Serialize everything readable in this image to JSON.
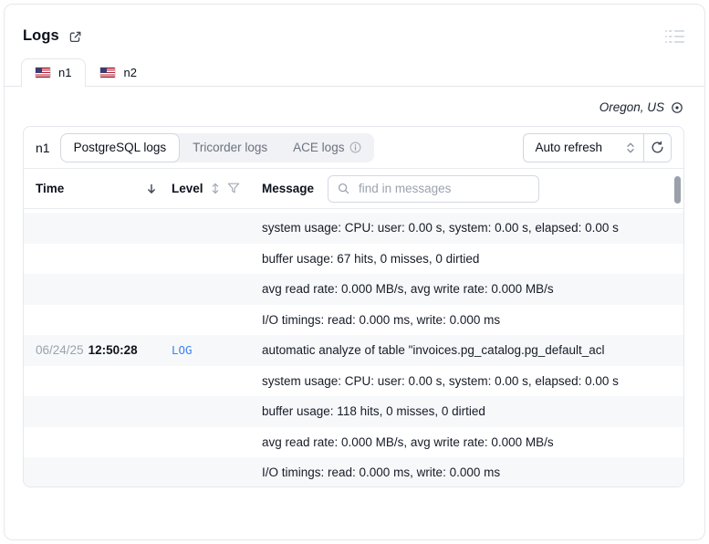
{
  "title": "Logs",
  "tabs": [
    {
      "label": "n1",
      "active": true,
      "flag": "us-flag"
    },
    {
      "label": "n2",
      "active": false,
      "flag": "us-flag"
    }
  ],
  "region": {
    "label": "Oregon, US"
  },
  "toolbar": {
    "instance": "n1",
    "log_source_tabs": [
      {
        "label": "PostgreSQL logs",
        "active": true
      },
      {
        "label": "Tricorder logs",
        "active": false
      },
      {
        "label": "ACE logs",
        "active": false,
        "info": true
      }
    ],
    "refresh_select": "Auto refresh"
  },
  "table": {
    "columns": {
      "time": "Time",
      "level": "Level",
      "message": "Message"
    },
    "search": {
      "placeholder": "find in messages",
      "value": ""
    },
    "rows": [
      {
        "date": "",
        "time": "",
        "level": "",
        "message": "system usage: CPU: user: 0.00 s, system: 0.00 s, elapsed: 0.00 s"
      },
      {
        "date": "",
        "time": "",
        "level": "",
        "message": "buffer usage: 67 hits, 0 misses, 0 dirtied"
      },
      {
        "date": "",
        "time": "",
        "level": "",
        "message": "avg read rate: 0.000 MB/s, avg write rate: 0.000 MB/s"
      },
      {
        "date": "",
        "time": "",
        "level": "",
        "message": "I/O timings: read: 0.000 ms, write: 0.000 ms"
      },
      {
        "date": "06/24/25",
        "time": "12:50:28",
        "level": "LOG",
        "message": "automatic analyze of table \"invoices.pg_catalog.pg_default_acl"
      },
      {
        "date": "",
        "time": "",
        "level": "",
        "message": "system usage: CPU: user: 0.00 s, system: 0.00 s, elapsed: 0.00 s"
      },
      {
        "date": "",
        "time": "",
        "level": "",
        "message": "buffer usage: 118 hits, 0 misses, 0 dirtied"
      },
      {
        "date": "",
        "time": "",
        "level": "",
        "message": "avg read rate: 0.000 MB/s, avg write rate: 0.000 MB/s"
      },
      {
        "date": "",
        "time": "",
        "level": "",
        "message": "I/O timings: read: 0.000 ms, write: 0.000 ms"
      }
    ]
  },
  "icons": {
    "external-link": "box with arrow pointing out top-right",
    "widget-menu": "three-line list glyph (drag/menu)",
    "location": "circle with center dot",
    "select-chevrons": "up and down chevrons",
    "refresh": "circular arrow",
    "sort-desc": "down arrow",
    "sort-both": "double-headed vertical arrow",
    "filter": "funnel outline",
    "search": "magnifier",
    "info": "circled i"
  },
  "colors": {
    "log_level_blue": "#3b82f6",
    "border": "#e4e7ec",
    "row_shade": "#f7f8fa",
    "muted_text": "#9aa3af"
  }
}
